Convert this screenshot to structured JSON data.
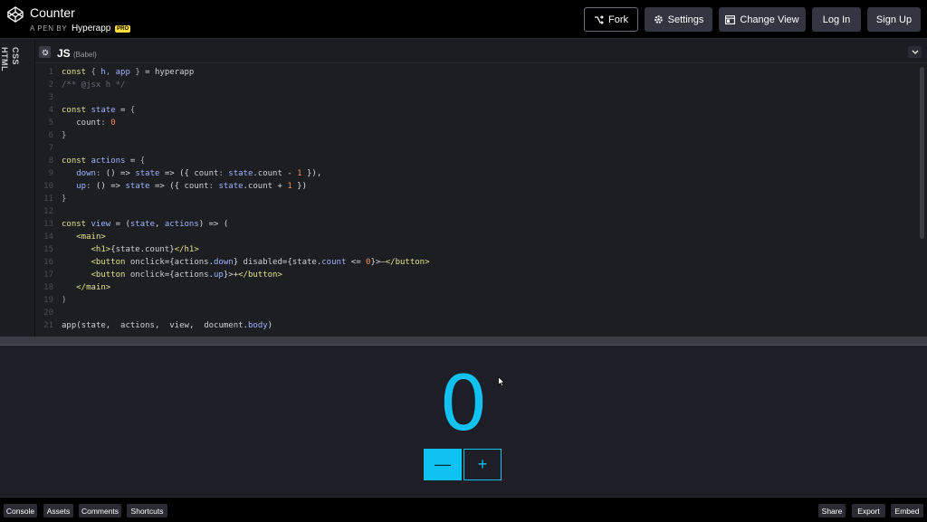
{
  "header": {
    "title": "Counter",
    "byline_prefix": "A PEN BY",
    "author": "Hyperapp",
    "badge": "PRO",
    "buttons": {
      "fork": "Fork",
      "settings": "Settings",
      "change_view": "Change View",
      "login": "Log In",
      "signup": "Sign Up"
    }
  },
  "tabs": {
    "html": "HTML",
    "css": "CSS"
  },
  "editor": {
    "language": "JS",
    "preprocessor": "(Babel)"
  },
  "code_lines": [
    "1",
    "2",
    "3",
    "4",
    "5",
    "6",
    "7",
    "8",
    "9",
    "10",
    "11",
    "12",
    "13",
    "14",
    "15",
    "16",
    "17",
    "18",
    "19",
    "20",
    "21"
  ],
  "preview": {
    "count": "0",
    "down_label": "—",
    "up_label": "+"
  },
  "footer": {
    "console": "Console",
    "assets": "Assets",
    "comments": "Comments",
    "shortcuts": "Shortcuts",
    "share": "Share",
    "export": "Export",
    "embed": "Embed"
  },
  "colors": {
    "accent": "#10c2f2",
    "header_bg": "#000000",
    "editor_bg": "#1d1e22",
    "badge": "#ffdd40"
  }
}
